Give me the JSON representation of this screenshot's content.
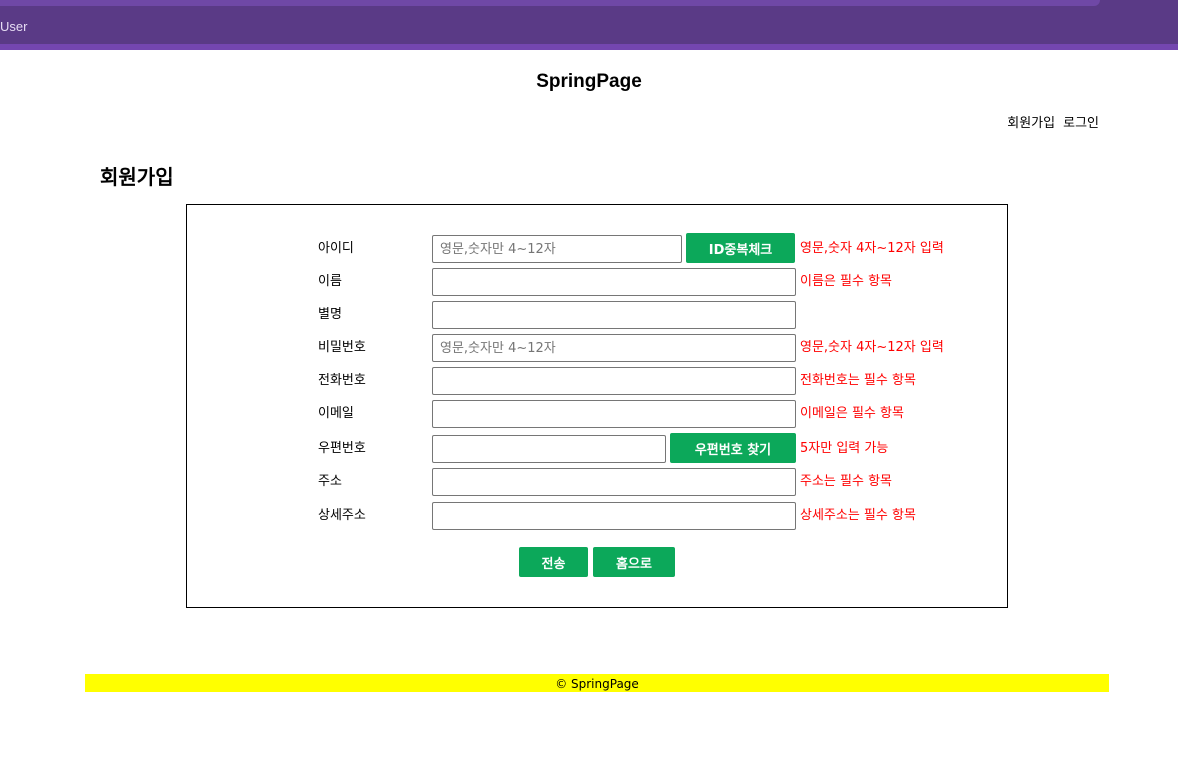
{
  "browser": {
    "tab_label": "User"
  },
  "header": {
    "title": "SpringPage",
    "nav": [
      {
        "label": "회원가입"
      },
      {
        "label": "로그인"
      }
    ]
  },
  "page": {
    "heading": "회원가입"
  },
  "form": {
    "fields": [
      {
        "label": "아이디",
        "placeholder": "영문,숫자만 4~12자",
        "value": "",
        "message": "영문,숫자 4자~12자 입력"
      },
      {
        "label": "이름",
        "placeholder": "",
        "value": "",
        "message": "이름은 필수 항목"
      },
      {
        "label": "별명",
        "placeholder": "",
        "value": "",
        "message": ""
      },
      {
        "label": "비밀번호",
        "placeholder": "영문,숫자만 4~12자",
        "value": "",
        "message": "영문,숫자 4자~12자 입력"
      },
      {
        "label": "전화번호",
        "placeholder": "",
        "value": "",
        "message": "전화번호는 필수 항목"
      },
      {
        "label": "이메일",
        "placeholder": "",
        "value": "",
        "message": "이메일은 필수 항목"
      },
      {
        "label": "우편번호",
        "placeholder": "",
        "value": "",
        "message": "5자만 입력 가능"
      },
      {
        "label": "주소",
        "placeholder": "",
        "value": "",
        "message": "주소는 필수 항목"
      },
      {
        "label": "상세주소",
        "placeholder": "",
        "value": "",
        "message": "상세주소는 필수 항목"
      }
    ],
    "id_check_button": "ID중복체크",
    "zipcode_button": "우편번호 찾기",
    "submit_button": "전송",
    "home_button": "홈으로"
  },
  "footer": {
    "text": "© SpringPage"
  },
  "colors": {
    "button_green": "#0ca85a",
    "error_red": "#ff0000",
    "footer_yellow": "#ffff00",
    "browser_purple": "#5a3a86"
  }
}
